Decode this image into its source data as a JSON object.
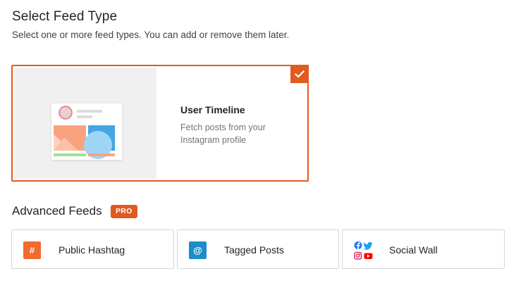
{
  "header": {
    "title": "Select Feed Type",
    "subtitle": "Select one or more feed types. You can add or remove them later."
  },
  "timeline": {
    "title": "User Timeline",
    "description": "Fetch posts from your Instagram profile",
    "selected": true
  },
  "advanced": {
    "title": "Advanced Feeds",
    "badge": "PRO",
    "items": [
      {
        "label": "Public Hashtag",
        "icon": "hashtag-icon",
        "glyph": "#",
        "color": "#f26a2e"
      },
      {
        "label": "Tagged Posts",
        "icon": "at-sign-icon",
        "glyph": "@",
        "color": "#1a8ec7"
      },
      {
        "label": "Social Wall",
        "icon": "social-wall-icons",
        "glyph": "",
        "color": ""
      }
    ]
  },
  "colors": {
    "accent": "#e15a1f",
    "facebook": "#1877f2",
    "twitter": "#1da1f2",
    "instagram": "#e1306c",
    "youtube": "#ff0000"
  }
}
